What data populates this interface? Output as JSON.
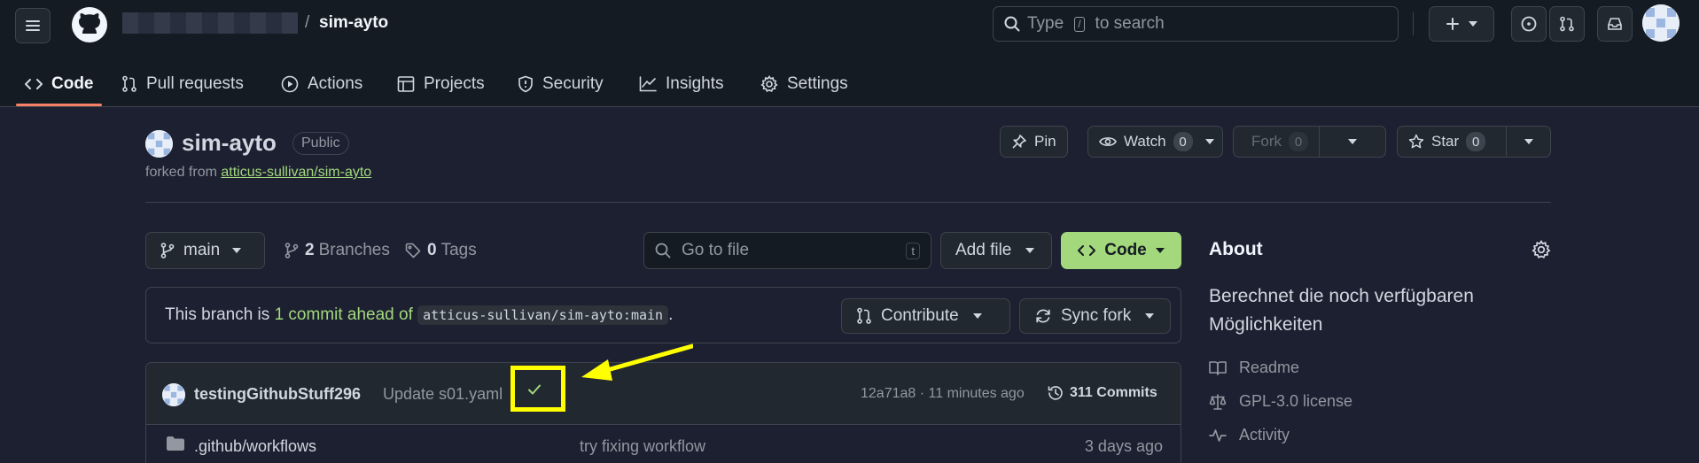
{
  "header": {
    "repo_name": "sim-ayto",
    "separator": "/",
    "search_before": "Type",
    "search_key": "/",
    "search_after": "to search"
  },
  "tabs": [
    {
      "label": "Code",
      "icon": "code-icon"
    },
    {
      "label": "Pull requests",
      "icon": "pull-request-icon"
    },
    {
      "label": "Actions",
      "icon": "play-icon"
    },
    {
      "label": "Projects",
      "icon": "table-icon"
    },
    {
      "label": "Security",
      "icon": "shield-icon"
    },
    {
      "label": "Insights",
      "icon": "graph-icon"
    },
    {
      "label": "Settings",
      "icon": "gear-icon"
    }
  ],
  "repo": {
    "title": "sim-ayto",
    "visibility": "Public",
    "forked_prefix": "forked from",
    "forked_link": "atticus-sullivan/sim-ayto",
    "pin_label": "Pin",
    "watch_label": "Watch",
    "watch_count": "0",
    "fork_label": "Fork",
    "fork_count": "0",
    "star_label": "Star",
    "star_count": "0"
  },
  "toolbar": {
    "branch": "main",
    "branches_count": "2",
    "branches_label": "Branches",
    "tags_count": "0",
    "tags_label": "Tags",
    "goto_placeholder": "Go to file",
    "goto_key": "t",
    "add_file_label": "Add file",
    "code_label": "Code"
  },
  "ahead": {
    "prefix": "This branch is",
    "link": "1 commit ahead of",
    "ref": "atticus-sullivan/sim-ayto:main",
    "suffix": ".",
    "contribute_label": "Contribute",
    "sync_label": "Sync fork"
  },
  "commit": {
    "author": "testingGithubStuff296",
    "message": "Update s01.yaml",
    "meta": "12a71a8 · 11 minutes ago",
    "count_label": "311 Commits"
  },
  "files": [
    {
      "name": ".github/workflows",
      "message": "try fixing workflow",
      "date": "3 days ago"
    }
  ],
  "about": {
    "title": "About",
    "description": "Berechnet die noch verfügbaren Möglichkeiten",
    "items": [
      {
        "label": "Readme",
        "icon": "book-icon"
      },
      {
        "label": "GPL-3.0 license",
        "icon": "law-icon"
      },
      {
        "label": "Activity",
        "icon": "pulse-icon"
      }
    ]
  },
  "colors": {
    "accent_green": "#a3d87d",
    "annotation_yellow": "#ffff00",
    "background": "#1c2030"
  }
}
